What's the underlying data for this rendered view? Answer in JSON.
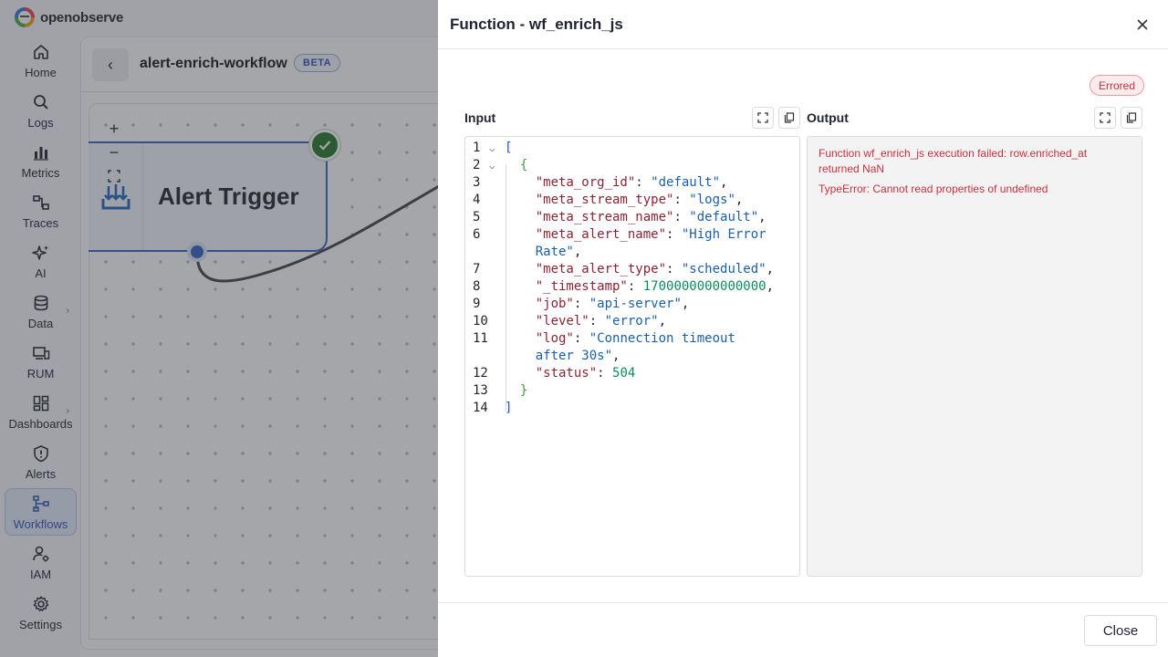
{
  "app": {
    "name": "openobserve"
  },
  "sidebar": {
    "items": [
      {
        "label": "Home",
        "icon": "home-icon"
      },
      {
        "label": "Logs",
        "icon": "search-icon"
      },
      {
        "label": "Metrics",
        "icon": "bar-chart-icon"
      },
      {
        "label": "Traces",
        "icon": "traces-icon"
      },
      {
        "label": "AI",
        "icon": "sparkle-icon"
      },
      {
        "label": "Data",
        "icon": "database-icon",
        "has_submenu": true
      },
      {
        "label": "RUM",
        "icon": "devices-icon"
      },
      {
        "label": "Dashboards",
        "icon": "dashboard-grid-icon",
        "has_submenu": true
      },
      {
        "label": "Alerts",
        "icon": "shield-alert-icon"
      },
      {
        "label": "Workflows",
        "icon": "workflow-icon",
        "active": true
      },
      {
        "label": "IAM",
        "icon": "user-gear-icon"
      },
      {
        "label": "Settings",
        "icon": "gear-icon"
      }
    ],
    "active_color": "#3a5bb8"
  },
  "workflow": {
    "name": "alert-enrich-workflow",
    "badge": "BETA",
    "node": {
      "title": "Alert Trigger",
      "status": "success"
    }
  },
  "dialog": {
    "title": "Function - wf_enrich_js",
    "status": "Errored",
    "input_label": "Input",
    "output_label": "Output",
    "input_lines": [
      {
        "n": "1",
        "fold": true,
        "indent": 0,
        "tokens": [
          {
            "t": "[",
            "c": "tok-br"
          }
        ]
      },
      {
        "n": "2",
        "fold": true,
        "indent": 1,
        "tokens": [
          {
            "t": "{",
            "c": "tok-br2"
          }
        ]
      },
      {
        "n": "3",
        "indent": 2,
        "tokens": [
          {
            "t": "\"meta_org_id\"",
            "c": "tok-key"
          },
          {
            "t": ": ",
            "c": "tok-p"
          },
          {
            "t": "\"default\"",
            "c": "tok-str"
          },
          {
            "t": ",",
            "c": "tok-p"
          }
        ]
      },
      {
        "n": "4",
        "indent": 2,
        "tokens": [
          {
            "t": "\"meta_stream_type\"",
            "c": "tok-key"
          },
          {
            "t": ": ",
            "c": "tok-p"
          },
          {
            "t": "\"logs\"",
            "c": "tok-str"
          },
          {
            "t": ",",
            "c": "tok-p"
          }
        ]
      },
      {
        "n": "5",
        "indent": 2,
        "tokens": [
          {
            "t": "\"meta_stream_name\"",
            "c": "tok-key"
          },
          {
            "t": ": ",
            "c": "tok-p"
          },
          {
            "t": "\"default\"",
            "c": "tok-str"
          },
          {
            "t": ",",
            "c": "tok-p"
          }
        ]
      },
      {
        "n": "6",
        "indent": 2,
        "tokens": [
          {
            "t": "\"meta_alert_name\"",
            "c": "tok-key"
          },
          {
            "t": ": ",
            "c": "tok-p"
          },
          {
            "t": "\"High Error",
            "c": "tok-str"
          }
        ]
      },
      {
        "n": "",
        "indent": 2,
        "tokens": [
          {
            "t": "Rate\"",
            "c": "tok-str"
          },
          {
            "t": ",",
            "c": "tok-p"
          }
        ]
      },
      {
        "n": "7",
        "indent": 2,
        "tokens": [
          {
            "t": "\"meta_alert_type\"",
            "c": "tok-key"
          },
          {
            "t": ": ",
            "c": "tok-p"
          },
          {
            "t": "\"scheduled\"",
            "c": "tok-str"
          },
          {
            "t": ",",
            "c": "tok-p"
          }
        ]
      },
      {
        "n": "8",
        "indent": 2,
        "tokens": [
          {
            "t": "\"_timestamp\"",
            "c": "tok-key"
          },
          {
            "t": ": ",
            "c": "tok-p"
          },
          {
            "t": "1700000000000000",
            "c": "tok-num"
          },
          {
            "t": ",",
            "c": "tok-p"
          }
        ]
      },
      {
        "n": "9",
        "indent": 2,
        "tokens": [
          {
            "t": "\"job\"",
            "c": "tok-key"
          },
          {
            "t": ": ",
            "c": "tok-p"
          },
          {
            "t": "\"api-server\"",
            "c": "tok-str"
          },
          {
            "t": ",",
            "c": "tok-p"
          }
        ]
      },
      {
        "n": "10",
        "indent": 2,
        "tokens": [
          {
            "t": "\"level\"",
            "c": "tok-key"
          },
          {
            "t": ": ",
            "c": "tok-p"
          },
          {
            "t": "\"error\"",
            "c": "tok-str"
          },
          {
            "t": ",",
            "c": "tok-p"
          }
        ]
      },
      {
        "n": "11",
        "indent": 2,
        "tokens": [
          {
            "t": "\"log\"",
            "c": "tok-key"
          },
          {
            "t": ": ",
            "c": "tok-p"
          },
          {
            "t": "\"Connection timeout",
            "c": "tok-str"
          }
        ]
      },
      {
        "n": "",
        "indent": 2,
        "tokens": [
          {
            "t": "after 30s\"",
            "c": "tok-str"
          },
          {
            "t": ",",
            "c": "tok-p"
          }
        ]
      },
      {
        "n": "12",
        "indent": 2,
        "tokens": [
          {
            "t": "\"status\"",
            "c": "tok-key"
          },
          {
            "t": ": ",
            "c": "tok-p"
          },
          {
            "t": "504",
            "c": "tok-num"
          }
        ]
      },
      {
        "n": "13",
        "indent": 1,
        "tokens": [
          {
            "t": "}",
            "c": "tok-br2"
          }
        ]
      },
      {
        "n": "14",
        "indent": 0,
        "tokens": [
          {
            "t": "]",
            "c": "tok-br"
          }
        ]
      }
    ],
    "output_lines": [
      "Function wf_enrich_js execution failed: row.enriched_at returned NaN",
      "TypeError: Cannot read properties of undefined"
    ],
    "close_label": "Close"
  },
  "colors": {
    "error": "#c7303d",
    "accent": "#3d6ac9",
    "success": "#2e7d32"
  }
}
